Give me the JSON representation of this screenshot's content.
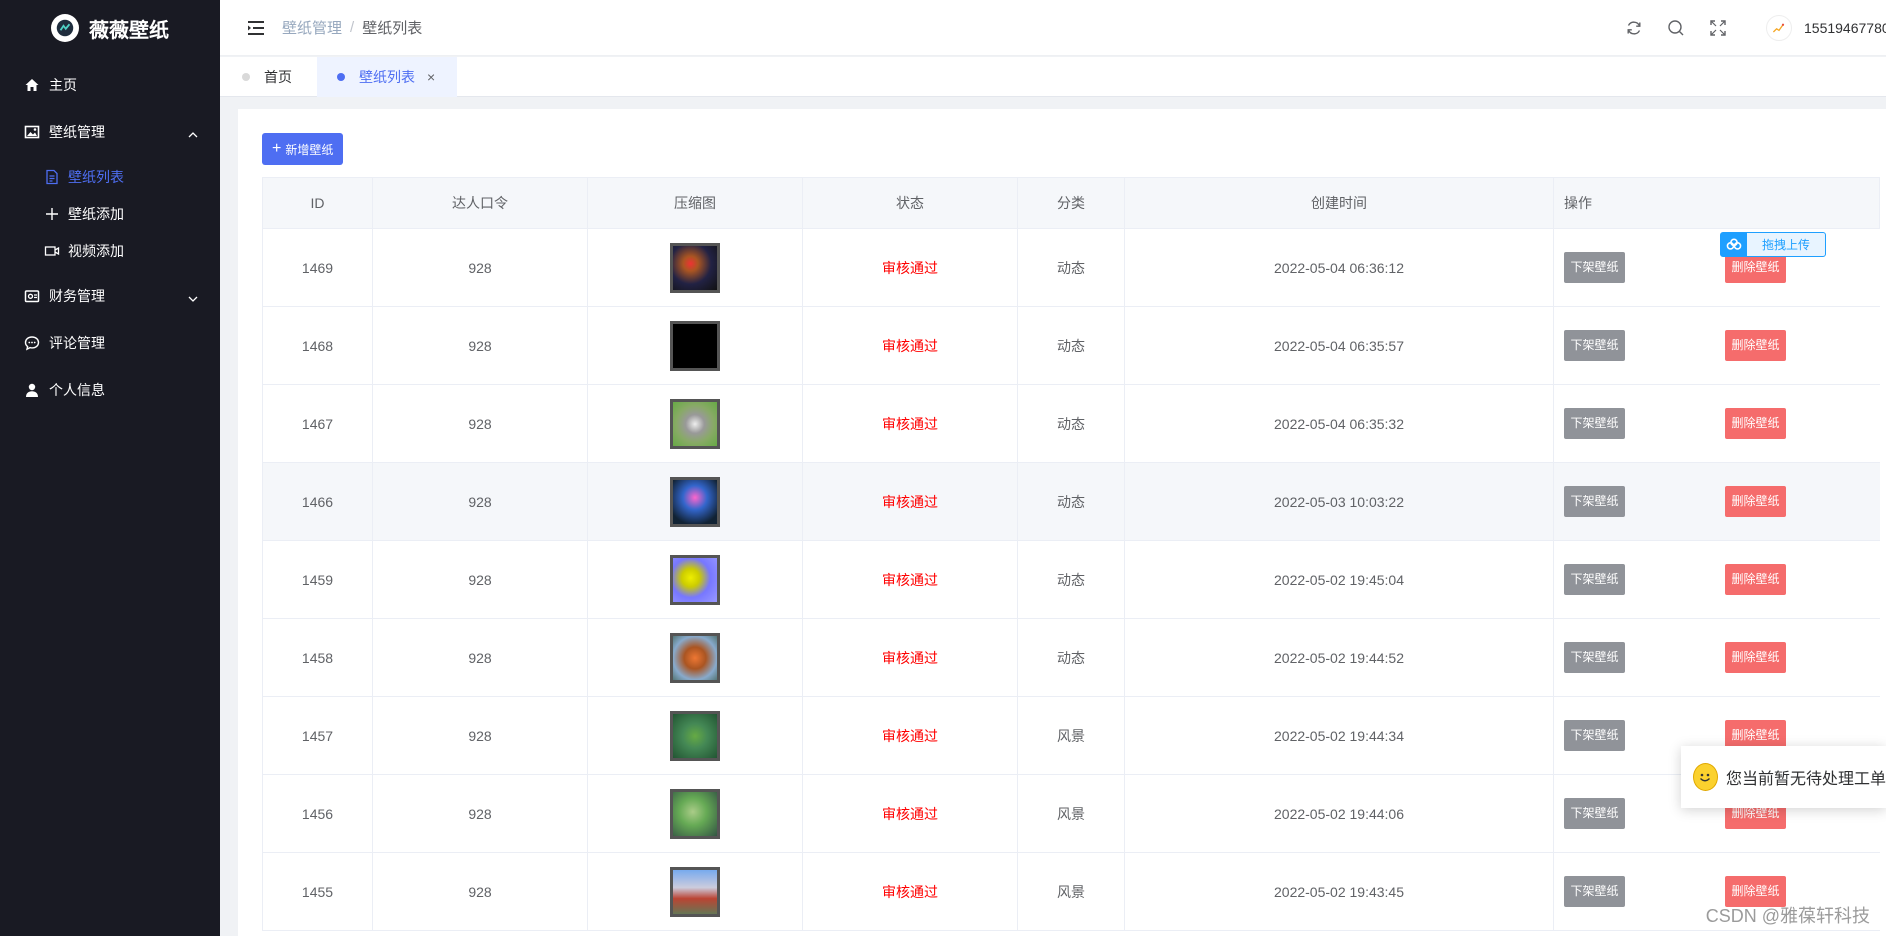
{
  "app": {
    "logo_text": "薇薇壁纸"
  },
  "sidebar": {
    "items": [
      {
        "label": "主页"
      },
      {
        "label": "壁纸管理"
      },
      {
        "label": "财务管理"
      },
      {
        "label": "评论管理"
      },
      {
        "label": "个人信息"
      }
    ],
    "submenu": [
      {
        "label": "壁纸列表"
      },
      {
        "label": "壁纸添加"
      },
      {
        "label": "视频添加"
      }
    ]
  },
  "header": {
    "breadcrumb": [
      "壁纸管理",
      "壁纸列表"
    ],
    "separator": "/",
    "username": "15519467780"
  },
  "tabs": [
    {
      "label": "首页"
    },
    {
      "label": "壁纸列表",
      "close": "×"
    }
  ],
  "toolbar": {
    "add_label": "新增壁纸"
  },
  "table": {
    "columns": [
      "ID",
      "达人口令",
      "压缩图",
      "状态",
      "分类",
      "创建时间",
      "操作"
    ],
    "rows": [
      {
        "id": "1469",
        "code": "928",
        "status": "审核通过",
        "category": "动态",
        "created": "2022-05-04 06:36:12"
      },
      {
        "id": "1468",
        "code": "928",
        "status": "审核通过",
        "category": "动态",
        "created": "2022-05-04 06:35:57"
      },
      {
        "id": "1467",
        "code": "928",
        "status": "审核通过",
        "category": "动态",
        "created": "2022-05-04 06:35:32"
      },
      {
        "id": "1466",
        "code": "928",
        "status": "审核通过",
        "category": "动态",
        "created": "2022-05-03 10:03:22"
      },
      {
        "id": "1459",
        "code": "928",
        "status": "审核通过",
        "category": "动态",
        "created": "2022-05-02 19:45:04"
      },
      {
        "id": "1458",
        "code": "928",
        "status": "审核通过",
        "category": "动态",
        "created": "2022-05-02 19:44:52"
      },
      {
        "id": "1457",
        "code": "928",
        "status": "审核通过",
        "category": "风景",
        "created": "2022-05-02 19:44:34"
      },
      {
        "id": "1456",
        "code": "928",
        "status": "审核通过",
        "category": "风景",
        "created": "2022-05-02 19:44:06"
      },
      {
        "id": "1455",
        "code": "928",
        "status": "审核通过",
        "category": "风景",
        "created": "2022-05-02 19:43:45"
      }
    ],
    "offline_label": "下架壁纸",
    "delete_label": "删除壁纸"
  },
  "float_upload": {
    "label": "拖拽上传"
  },
  "notice": {
    "text": "您当前暂无待处理工单"
  },
  "watermark": "CSDN @雅葆轩科技",
  "colors": {
    "sidebar_bg": "#191a23",
    "accent": "#4e6ef2",
    "danger": "#f56c6c",
    "status": "#ff0000",
    "muted_btn": "#909399"
  },
  "icons": {
    "sidebar": [
      "home-icon",
      "image-icon",
      "wallet-icon",
      "comment-icon",
      "user-icon"
    ],
    "header": [
      "refresh-icon",
      "search-icon",
      "fullscreen-icon"
    ]
  }
}
